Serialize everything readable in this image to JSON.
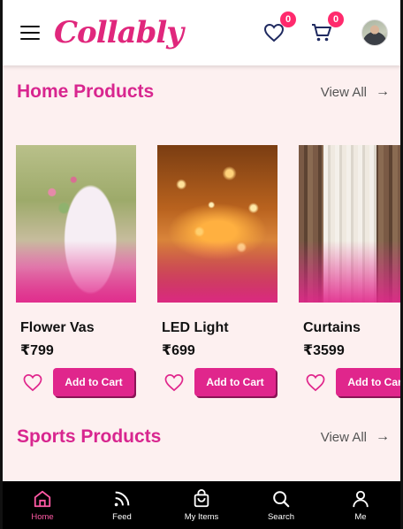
{
  "header": {
    "logo": "Collably",
    "wishlist_count": "0",
    "cart_count": "0"
  },
  "sections": [
    {
      "title": "Home Products",
      "view_all": "View All"
    },
    {
      "title": "Sports Products",
      "view_all": "View All"
    }
  ],
  "products": [
    {
      "name": "Flower Vas",
      "price": "₹799",
      "button": "Add to Cart"
    },
    {
      "name": "LED Light",
      "price": "₹699",
      "button": "Add to Cart"
    },
    {
      "name": "Curtains",
      "price": "₹3599",
      "button": "Add to Cart"
    }
  ],
  "nav": [
    {
      "label": "Home",
      "icon": "home-icon"
    },
    {
      "label": "Feed",
      "icon": "rss-icon"
    },
    {
      "label": "My Items",
      "icon": "bag-icon"
    },
    {
      "label": "Search",
      "icon": "search-icon"
    },
    {
      "label": "Me",
      "icon": "user-icon"
    }
  ],
  "colors": {
    "accent": "#e0268c",
    "logo": "#e0277c",
    "badge": "#ff2a6d",
    "background": "#fdf0f0"
  }
}
